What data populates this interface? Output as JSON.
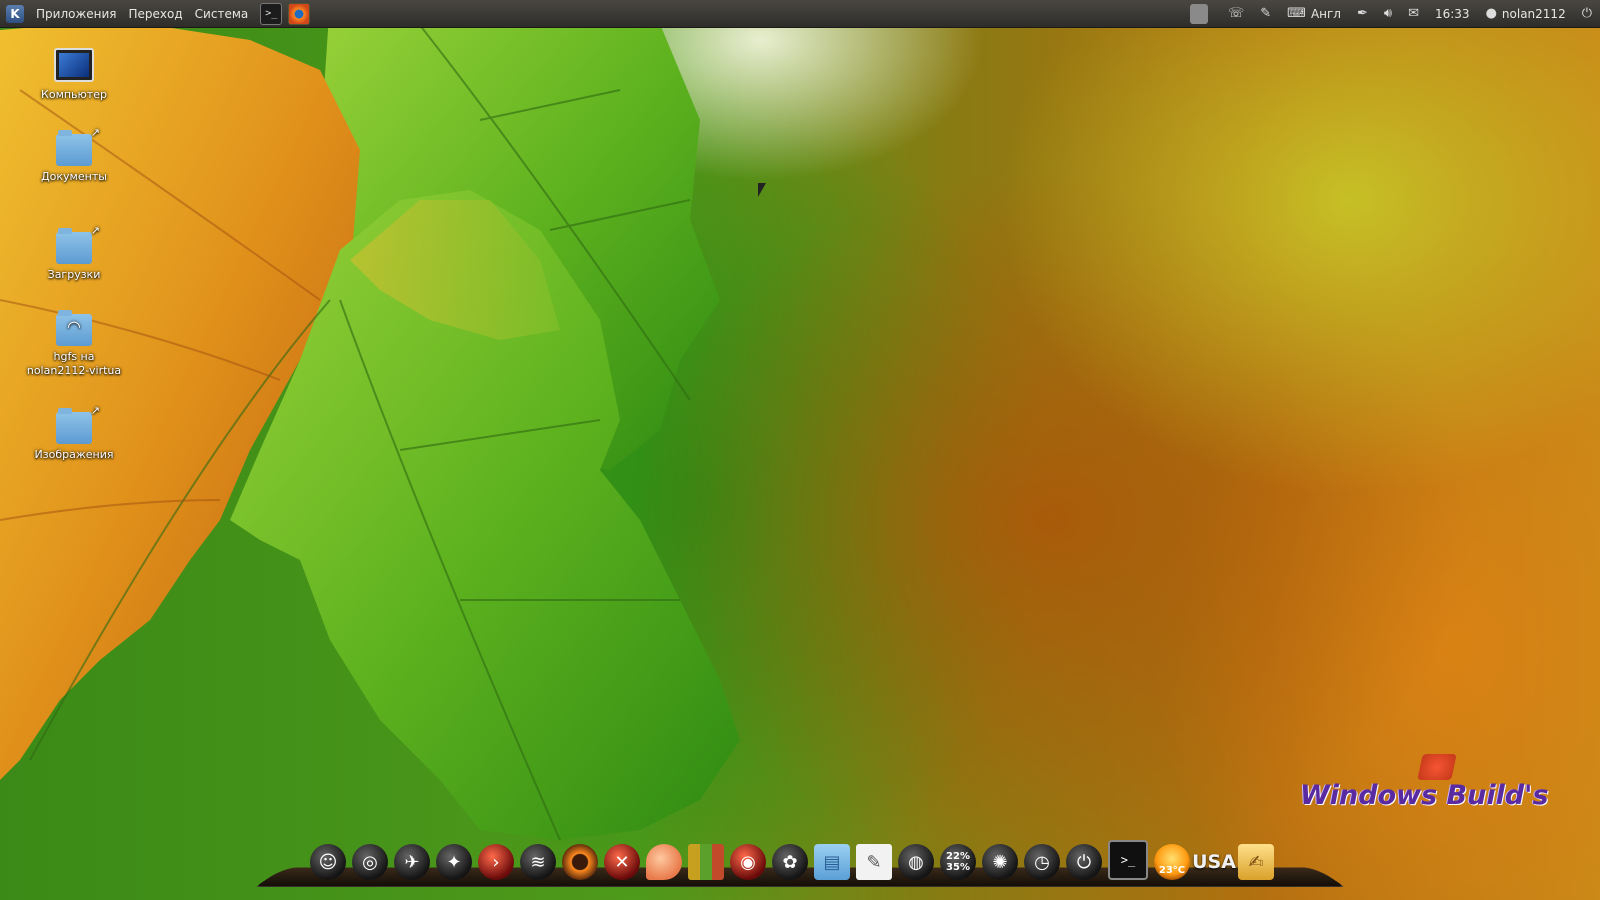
{
  "top_panel": {
    "menus": [
      "Приложения",
      "Переход",
      "Система"
    ],
    "launchers": [
      {
        "icon": "terminal-icon",
        "glyph": ">_"
      },
      {
        "icon": "web-browser-icon",
        "glyph": ""
      }
    ],
    "tray": {
      "keyboard_layout": "Англ",
      "clock": "16:33",
      "user": "nolan2112"
    }
  },
  "desktop_icons": [
    {
      "label": "Компьютер",
      "icon": "computer-icon"
    },
    {
      "label": "Документы",
      "icon": "folder-icon"
    },
    {
      "label": "Загрузки",
      "icon": "folder-icon"
    },
    {
      "label": "hgfs на nolan2112-virtua",
      "icon": "network-share-icon"
    },
    {
      "label": "Изображения",
      "icon": "folder-icon"
    }
  ],
  "dock": {
    "system_monitor": {
      "top": "22%",
      "bottom": "35%"
    },
    "weather": {
      "temperature": "23°C"
    },
    "keyboard_label": "USA"
  },
  "watermark": "Windows Build's",
  "colors": {
    "panel": "#3a3835",
    "watermark": "#5a2aa0",
    "folder": "#6fa9da"
  }
}
